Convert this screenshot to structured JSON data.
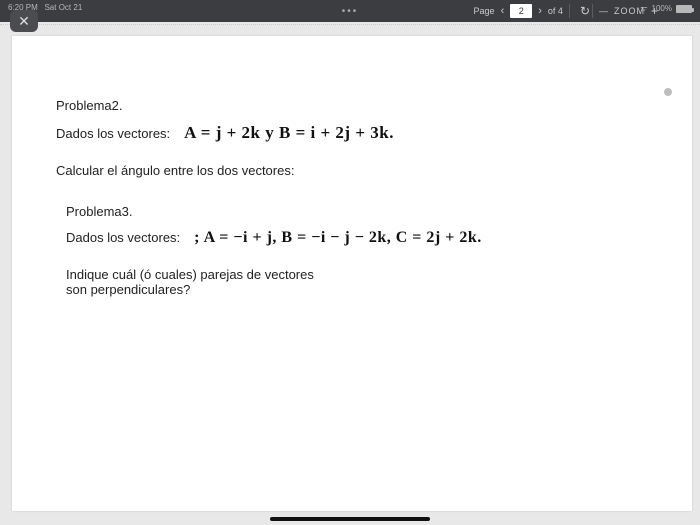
{
  "status": {
    "time": "6:20 PM",
    "date": "Sat Oct 21",
    "battery": "100%"
  },
  "nav": {
    "page_label": "Page",
    "page_current": "2",
    "of_label": "of 4",
    "zoom_label": "ZOOM"
  },
  "doc": {
    "problem2_title": "Problema2.",
    "given_label": "Dados los vectores:",
    "p2_math": "A = j + 2k y B = i + 2j + 3k.",
    "p2_instruction": "Calcular el ángulo entre los dos vectores:",
    "problem3_title": "Problema3.",
    "p3_math": "; A = −i + j, B = −i − j − 2k, C = 2j + 2k.",
    "p3_instruction_l1": "Indique cuál (ó cuales) parejas de vectores",
    "p3_instruction_l2": "son perpendiculares?"
  }
}
